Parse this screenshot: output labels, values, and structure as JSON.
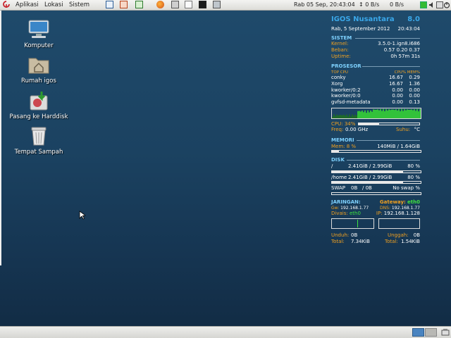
{
  "top_panel": {
    "menus": [
      "Aplikasi",
      "Lokasi",
      "Sistem"
    ],
    "launchers": [
      "document-icon",
      "presentation-icon",
      "spreadsheet-icon",
      "firefox-icon",
      "calculator-icon",
      "text-editor-icon",
      "terminal-icon",
      "screenshot-icon"
    ],
    "clock": "Rab 05 Sep, 20:43:04",
    "net_down": "0 B/s",
    "net_up": "0 B/s"
  },
  "desktop_icons": [
    "Komputer",
    "Rumah igos",
    "Pasang ke Harddisk",
    "Tempat Sampah"
  ],
  "conky": {
    "title": "IGOS Nusantara",
    "version": "8.0",
    "date": "Rab,  5 September 2012",
    "time": "20:43:04",
    "sistem": {
      "header": "SISTEM",
      "kernel_label": "Kernel:",
      "kernel": "3.5.0-1.ign8.i686",
      "beban_label": "Beban:",
      "beban": "0.57 0.20 0.37",
      "uptime_label": "Uptime:",
      "uptime": "0h 57m 31s"
    },
    "prosesor": {
      "header": "PROSESOR",
      "top_cpu": "TOP CPU",
      "cols": "CPU% MEM%",
      "processes": [
        {
          "name": "conky",
          "cpu": "16.67",
          "mem": "0.29"
        },
        {
          "name": "Xorg",
          "cpu": "16.67",
          "mem": "1.36"
        },
        {
          "name": "kworker/0:2",
          "cpu": "0.00",
          "mem": "0.00"
        },
        {
          "name": "kworker/0:0",
          "cpu": "0.00",
          "mem": "0.00"
        },
        {
          "name": "gvfsd-metadata",
          "cpu": "0.00",
          "mem": "0.13"
        }
      ],
      "cpu_label": "CPU: 34%",
      "cpu_usage": 0.34,
      "freq_label": "Freq:",
      "freq": "0.00 GHz",
      "suhu_label": "Suhu:",
      "suhu": "°C"
    },
    "memori": {
      "header": "MEMORI",
      "mem_label": "Mem: 8 %",
      "mem_value": "140MiB / 1.64GiB",
      "mem_usage": 0.08
    },
    "disk": {
      "header": "DISK",
      "mounts": [
        {
          "mount": "/",
          "used": "2.41GiB / 2.99GiB",
          "pct": "80 %",
          "usage": 0.8
        },
        {
          "mount": "/home",
          "used": "2.41GiB / 2.99GiB",
          "pct": "80 %",
          "usage": 0.8
        }
      ],
      "swap_label": "SWAP",
      "swap_used": "0B",
      "swap_sep": "/ 0B",
      "swap_status": "No swap %",
      "swap_usage": 0
    },
    "jaringan": {
      "header": "JARINGAN:",
      "gateway_label": "Gateway:",
      "gateway_iface": "eth0",
      "gw_label": "Gw:",
      "gw": "192.168.1.77",
      "dns_label": "DNS:",
      "dns": "192.168.1.77",
      "divais_label": "Divais:",
      "divais": "eth0",
      "ip_label": "IP:",
      "ip": "192.168.1.128",
      "unduh_label": "Unduh:",
      "unduh": "0B",
      "unggah_label": "Unggah:",
      "unggah": "0B",
      "total_down_label": "Total:",
      "total_down": "7.34KiB",
      "total_up_label": "Total:",
      "total_up": "1.54KiB"
    }
  },
  "colors": {
    "accent_blue": "#3aa7e8",
    "section": "#7fd2ff",
    "orange": "#f0a020",
    "green": "#3fe23f"
  }
}
